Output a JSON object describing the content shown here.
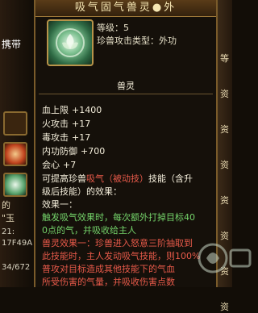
{
  "left_panel": {
    "label_carry": "携带",
    "label_char": "的",
    "label_quote": "\"玉",
    "coord_1": "21:",
    "coord_2": "17F49A",
    "coord_3": "34/672"
  },
  "right_panel": {
    "chars": [
      "等",
      "资",
      "资",
      "资",
      "资",
      "资",
      "资",
      "资"
    ]
  },
  "tooltip": {
    "title": "吸气固气兽灵●外",
    "level_label": "等级：5",
    "type_label": "珍兽攻击类型：外功",
    "section_title": "兽灵",
    "stats": [
      {
        "name": "血上限",
        "value": "+1400"
      },
      {
        "name": "火攻击",
        "value": "+17"
      },
      {
        "name": "毒攻击",
        "value": "+17"
      },
      {
        "name": "内功防御",
        "value": "+700"
      },
      {
        "name": "会心",
        "value": "+7"
      }
    ],
    "desc_line1_a": "可提高珍兽",
    "desc_line1_b": "吸气（被动技）",
    "desc_line1_c": "技能（含升",
    "desc_line2": "级后技能）的效果：",
    "effect_title": "效果一：",
    "effect_lines": [
      "触发吸气技能：珍兽进入怒意三阶抽取到",
      "此技能时，主人发动吸气技能，则100%",
      "普攻对目标造成其他技能下的气血",
      "所受伤害的气量，并吸收伤害点数"
    ],
    "effect_green": [
      "触发吸气效果时，每次额外打掉目标40",
      "0点的气，并吸收给主人"
    ],
    "effect_red_title": "兽灵效果一：",
    "effect_red_lines": [
      "珍兽进入怒意三阶抽取到",
      "此技能时，主人发动吸气技能，则100%",
      "普攻对目标造成其他技能下的气血",
      "所受伤害的气量，并吸收伤害点数"
    ]
  },
  "colors": {
    "gold": "#b8944a",
    "green_text": "#74d36a",
    "red_text": "#e85a4a"
  }
}
